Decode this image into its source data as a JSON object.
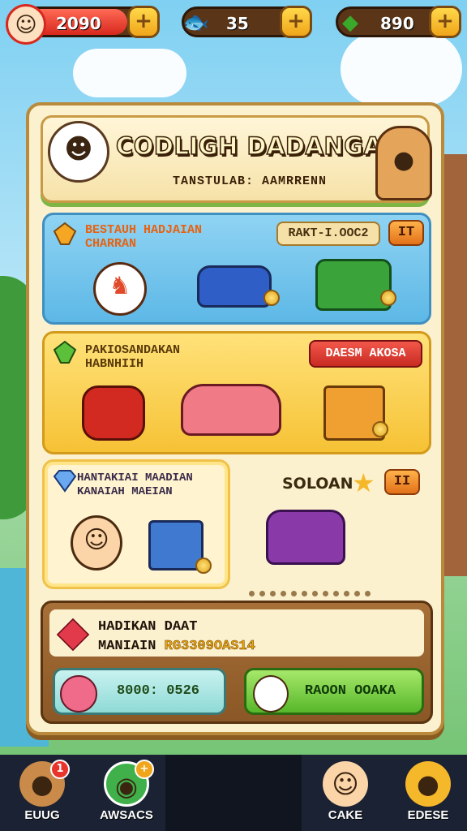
{
  "currencies": [
    {
      "value": "2090",
      "icon": "avatar-icon",
      "color": "#e8342a"
    },
    {
      "value": "35",
      "icon": "fish-icon",
      "color": "#5a3517"
    },
    {
      "value": "890",
      "icon": "green-gem-icon",
      "color": "#5a3517"
    }
  ],
  "header": {
    "title": "CODLIGH DADANGA!",
    "subtitle": "TANSTULAB: AAMRRENN"
  },
  "card1": {
    "label": "BESTAUH HADJAIAN\nCHARRAN",
    "tag": "RAKT-I.OOC2",
    "tag_num": "IT",
    "items": [
      "cat-mascot-icon",
      "blue-car-icon",
      "green-van-icon"
    ]
  },
  "card2": {
    "label": "PAKIOSANDAKAN\nHABNHIIH",
    "tag": "DAESM AKOSA",
    "items": [
      "red-barrel-icon",
      "pink-car-icon",
      "gift-box-icon"
    ]
  },
  "card3": {
    "label": "HANTAKIAI MAADIAN\nKANAIAH MAEIAN",
    "items": [
      "boy-avatar-icon",
      "blue-gift-icon"
    ]
  },
  "solo": {
    "label": "SOLOAN",
    "tag_num": "II",
    "item": "purple-car-icon"
  },
  "bottom_card": {
    "line1": "HADIKAN DAAT",
    "line2_prefix": "MANIAIN",
    "code": "RG3309OAS14",
    "btn_left": "8000: 0526",
    "btn_right": "RAOON OOAKA"
  },
  "nav": [
    {
      "label": "EUUG",
      "icon": "dog-icon",
      "badge": "1"
    },
    {
      "label": "AWSACS",
      "icon": "planet-icon",
      "badge": "+"
    },
    {
      "label": "CAKE",
      "icon": "boy-icon",
      "badge": ""
    },
    {
      "label": "EDESE",
      "icon": "duck-icon",
      "badge": ""
    }
  ],
  "colors": {
    "accent_gold": "#f0a51a",
    "panel": "#fbf1cf",
    "blue_card": "#5db8e6",
    "yellow_card": "#f6c235",
    "green_button": "#57b72a"
  }
}
